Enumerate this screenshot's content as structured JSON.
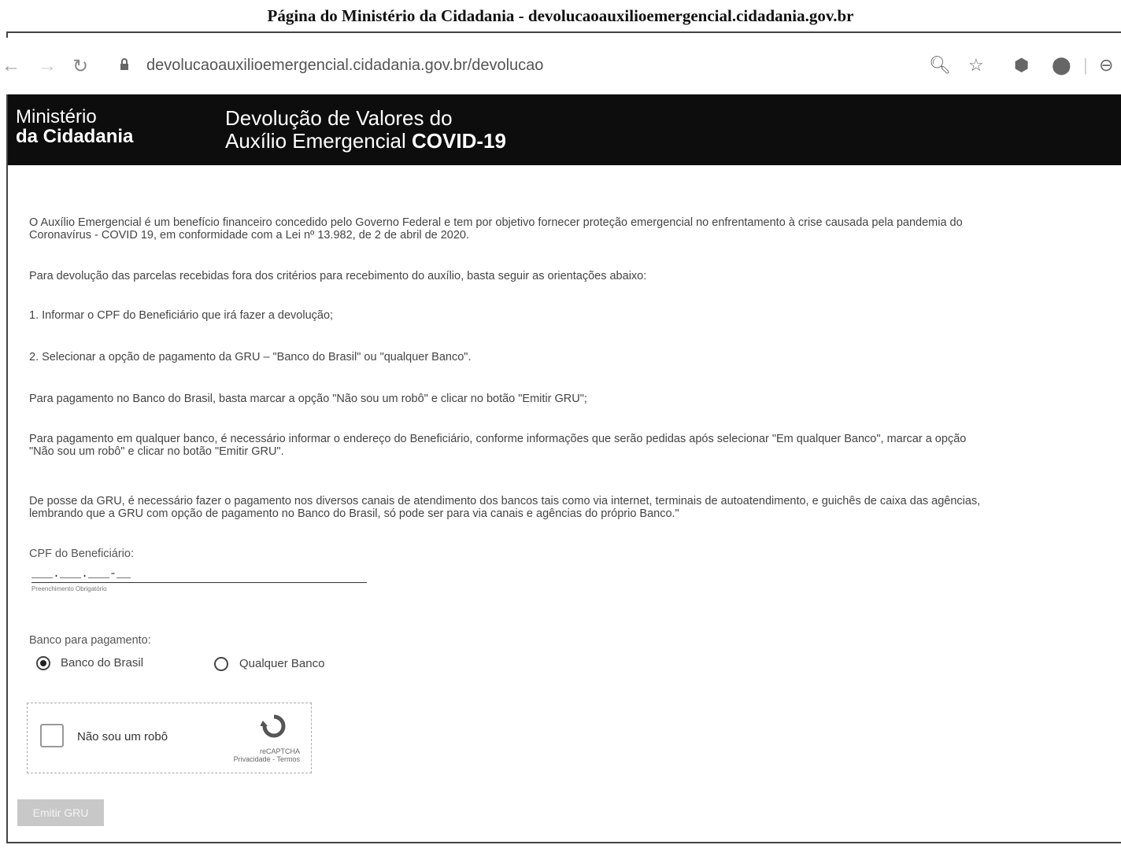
{
  "caption": "Página do Ministério da Cidadania - devolucaoauxilioemergencial.cidadania.gov.br",
  "browser": {
    "url": "devolucaoauxilioemergencial.cidadania.gov.br/devolucao",
    "icons": [
      "back-arrow-icon",
      "forward-arrow-icon",
      "reload-icon",
      "lock-icon",
      "zoom-icon",
      "star-icon",
      "extension-icon",
      "extension-icon-2",
      "profile-icon"
    ]
  },
  "header": {
    "ministry_line1": "Ministério",
    "ministry_line2": "da Cidadania",
    "title_line1": "Devolução de Valores do",
    "title_line2_a": "Auxílio Emergencial ",
    "title_line2_b": "COVID-19",
    "background": "#0d0d0d"
  },
  "content": {
    "intro_l1": "O Auxílio Emergencial é um benefício financeiro concedido pelo Governo Federal e tem por objetivo fornecer proteção emergencial no enfrentamento à crise causada pela pandemia do",
    "intro_l2": "Coronavírus - COVID 19, em conformidade com a Lei nº 13.982, de 2 de abril de 2020.",
    "instructions": "Para devolução das parcelas recebidas fora dos critérios para recebimento do auxílio, basta seguir as orientações abaixo:",
    "step1": "1. Informar o CPF do Beneficiário que irá fazer a devolução;",
    "step2": "2. Selecionar a opção de pagamento da GRU – \"Banco do Brasil\" ou \"qualquer Banco\".",
    "bb_payment": "Para pagamento no Banco do Brasil, basta marcar a opção \"Não sou um robô\" e clicar no botão \"Emitir GRU\";",
    "any_bank_l1": "Para pagamento em qualquer banco, é necessário informar o endereço do Beneficiário, conforme informações que serão pedidas após selecionar \"Em qualquer Banco\", marcar a opção",
    "any_bank_l2": "\"Não sou um robô\" e clicar no botão \"Emitir GRU\".",
    "gru_l1": "De posse da GRU, é necessário fazer o pagamento nos diversos canais de atendimento dos bancos tais como via internet, terminais de autoatendimento, e guichês de caixa das agências,",
    "gru_l2": "lembrando que a GRU com opção de pagamento no Banco do Brasil, só pode ser para via canais e agências do próprio Banco.\""
  },
  "form": {
    "cpf_label": "CPF do Beneficiário:",
    "cpf_value": "___.___.___-__",
    "cpf_hint": "Preenchimento Obrigatório",
    "bank_label": "Banco para pagamento:",
    "options": [
      {
        "label": "Banco do Brasil",
        "selected": true
      },
      {
        "label": "Qualquer Banco",
        "selected": false
      }
    ],
    "captcha_label": "Não sou um robô",
    "captcha_brand": "reCAPTCHA",
    "captcha_links": "Privacidade - Termos",
    "submit_label": "Emitir GRU"
  }
}
